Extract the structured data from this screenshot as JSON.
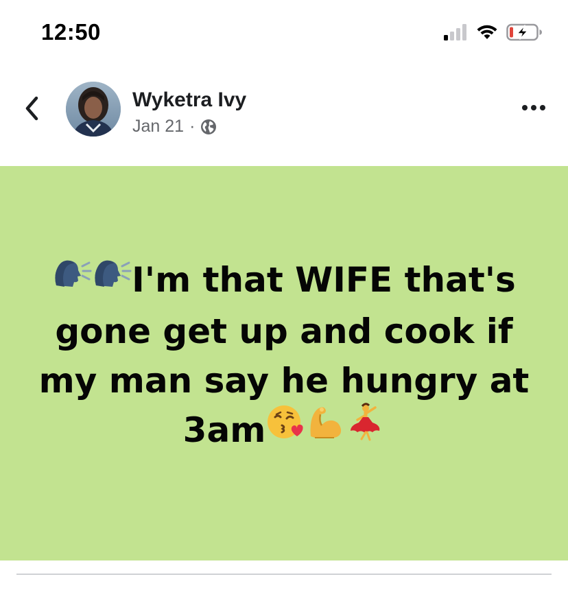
{
  "status_bar": {
    "time": "12:50",
    "icons": [
      "cellular-signal-icon",
      "wifi-icon",
      "battery-charging-icon"
    ]
  },
  "header": {
    "back_icon": "chevron-left-icon",
    "author_name": "Wyketra Ivy",
    "date": "Jan 21",
    "separator": "·",
    "audience_icon": "globe-icon",
    "more_icon": "more-horizontal-icon"
  },
  "post": {
    "background_color": "#c2e390",
    "text_color": "#050505",
    "text_start": "I'm that WIFE that's gone get up and cook if my man say he hungry at 3am",
    "leading_emojis": [
      "speaking-head-emoji",
      "speaking-head-emoji"
    ],
    "trailing_emojis": [
      "kiss-heart-emoji",
      "flexed-biceps-emoji",
      "dancer-emoji"
    ]
  },
  "colors": {
    "name_color": "#1c1e21",
    "meta_color": "#65676b",
    "divider_color": "#cfd1d5"
  }
}
